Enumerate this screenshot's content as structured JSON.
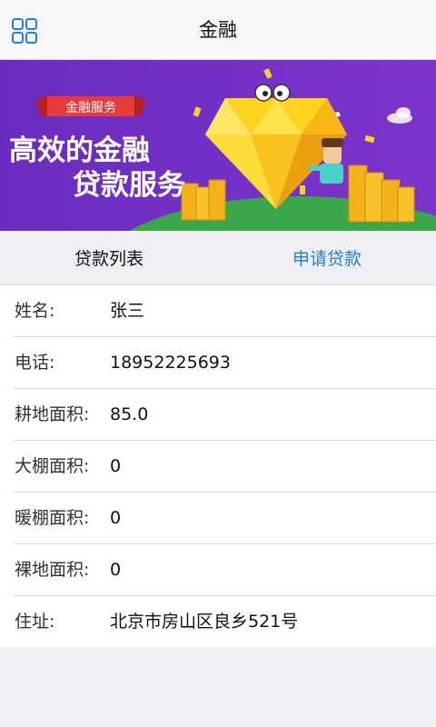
{
  "header": {
    "title": "金融",
    "menu_icon": "grid-menu-icon"
  },
  "banner": {
    "ribbon": "金融服务",
    "headline_line1": "高效的金融",
    "headline_line2": "贷款服务",
    "colors": {
      "background": "#7a2fc8",
      "diamond": "#ffd21e",
      "hill": "#3aa84a",
      "ribbon": "#e83a3a"
    }
  },
  "tabs": {
    "list_label": "贷款列表",
    "apply_label": "申请贷款",
    "active_color": "#1f7fe0"
  },
  "form": {
    "rows": [
      {
        "label": "姓名:",
        "value": "张三"
      },
      {
        "label": "电话:",
        "value": "18952225693"
      },
      {
        "label": "耕地面积:",
        "value": "85.0"
      },
      {
        "label": "大棚面积:",
        "value": "0"
      },
      {
        "label": "暖棚面积:",
        "value": "0"
      },
      {
        "label": "裸地面积:",
        "value": "0"
      },
      {
        "label": "住址:",
        "value": "北京市房山区良乡521号"
      }
    ]
  }
}
